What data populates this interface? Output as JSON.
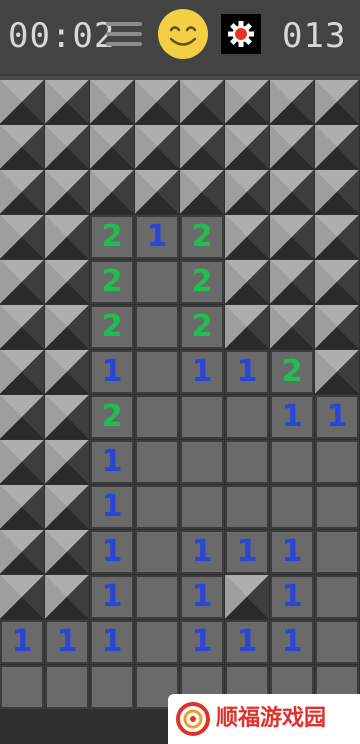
{
  "timer": {
    "value": "00:02"
  },
  "mine_counter": {
    "value": "013"
  },
  "colors": {
    "number_1": "#2a46d8",
    "number_2": "#1fbf4f",
    "digits": "#d8d8d8",
    "smiley": "#f2cf45",
    "settings_gear": "#e8332a"
  },
  "icons": {
    "menu": "hamburger-menu-icon",
    "smiley": "smiley-face-icon",
    "settings": "gear-icon"
  },
  "board": {
    "cols": 8,
    "rows": 14,
    "legend": "# = unopened tile, . = opened empty, digit = opened with count",
    "grid": [
      "########",
      "########",
      "########",
      "##212###",
      "##2.2###",
      "##2.2###",
      "##1.112#",
      "##2...11",
      "##1.....",
      "##1.....",
      "##1.111.",
      "##1.1#1.",
      "111.111.",
      "........"
    ]
  },
  "watermark": {
    "text": "顺福游戏园"
  }
}
